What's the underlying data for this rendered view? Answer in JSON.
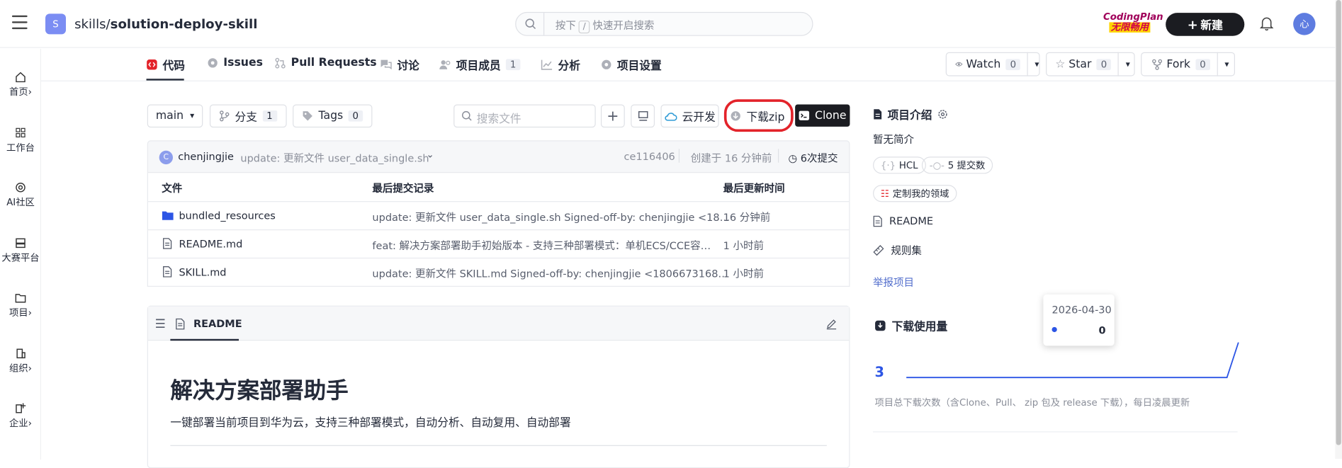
{
  "topbar": {
    "repo_avatar": "S",
    "repo_owner": "skills/",
    "repo_name": "solution-deploy-skill",
    "search_prefix": "按下",
    "search_key": "/",
    "search_suffix": "快速开启搜索",
    "badge_line1": "CodingPlan",
    "badge_line2": "无限畅用",
    "new_button": "新建",
    "user_avatar": "心"
  },
  "leftnav": [
    {
      "label": "首页",
      "icon": "home-icon",
      "arrow": "›"
    },
    {
      "label": "工作台",
      "icon": "grid-icon",
      "arrow": ""
    },
    {
      "label": "AI社区",
      "icon": "ai-icon",
      "arrow": ""
    },
    {
      "label": "大赛平台",
      "icon": "contest-icon",
      "arrow": ""
    },
    {
      "label": "项目",
      "icon": "folder-icon",
      "arrow": "›"
    },
    {
      "label": "组织",
      "icon": "org-icon",
      "arrow": "›"
    },
    {
      "label": "企业",
      "icon": "enterprise-icon",
      "arrow": "›"
    }
  ],
  "tabs": [
    {
      "label": "代码",
      "icon": "code-icon",
      "count": ""
    },
    {
      "label": "Issues",
      "icon": "issues-icon",
      "count": ""
    },
    {
      "label": "Pull Requests",
      "icon": "pr-icon",
      "count": ""
    },
    {
      "label": "讨论",
      "icon": "discuss-icon",
      "count": ""
    },
    {
      "label": "项目成员",
      "icon": "members-icon",
      "count": "1"
    },
    {
      "label": "分析",
      "icon": "analysis-icon",
      "count": ""
    },
    {
      "label": "项目设置",
      "icon": "settings-icon",
      "count": ""
    }
  ],
  "repo_actions": {
    "watch": {
      "label": "Watch",
      "count": "0"
    },
    "star": {
      "label": "Star",
      "count": "0"
    },
    "fork": {
      "label": "Fork",
      "count": "0"
    }
  },
  "toolbar": {
    "branch": "main",
    "branches_label": "分支",
    "branches_count": "1",
    "tags_label": "Tags",
    "tags_count": "0",
    "search_placeholder": "搜索文件",
    "cloud_dev": "云开发",
    "download_zip": "下载zip",
    "clone": "Clone"
  },
  "commit": {
    "author_initial": "C",
    "author": "chenjingjie",
    "message": "update: 更新文件 user_data_single.sh",
    "hash": "ce116406",
    "created": "创建于 16 分钟前",
    "commit_count": "6次提交"
  },
  "file_table": {
    "headers": [
      "文件",
      "最后提交记录",
      "最后更新时间"
    ],
    "rows": [
      {
        "name": "bundled_resources",
        "type": "folder",
        "message": "update: 更新文件 user_data_single.sh Signed-off-by: chenjingjie <18…",
        "time": "16 分钟前"
      },
      {
        "name": "README.md",
        "type": "file",
        "message": "feat: 解决方案部署助手初始版本 - 支持三种部署模式：单机ECS/CCE容…",
        "time": "1 小时前"
      },
      {
        "name": "SKILL.md",
        "type": "file",
        "message": "update: 更新文件 SKILL.md Signed-off-by: chenjingjie <1806673168…",
        "time": "1 小时前"
      }
    ]
  },
  "readme": {
    "tab_label": "README",
    "title": "解决方案部署助手",
    "subtitle": "一键部署当前项目到华为云，支持三种部署模式，自动分析、自动复用、自动部署"
  },
  "sidebar": {
    "intro_title": "项目介绍",
    "intro_text": "暂无简介",
    "lang_tag": "HCL",
    "commits_tag": "5 提交数",
    "domain_tag": "定制我的领域",
    "readme_link": "README",
    "rules_link": "规则集",
    "report_link": "举报项目",
    "downloads_title": "下载使用量",
    "downloads_total": "3",
    "downloads_note": "项目总下载次数（含Clone、Pull、 zip 包及 release 下载），每日凌晨更新",
    "tooltip_date": "2026-04-30",
    "tooltip_value": "0"
  },
  "chart_data": {
    "type": "line",
    "title": "下载使用量",
    "series": [
      {
        "values": [
          0,
          0,
          0,
          0,
          0,
          0,
          0,
          0,
          0,
          0,
          0,
          0,
          0,
          0,
          0,
          0,
          0,
          0,
          0,
          0,
          0,
          0,
          0,
          0,
          0,
          0,
          0,
          0,
          0,
          3
        ]
      }
    ],
    "total": 3,
    "grid": false,
    "colors": {
      "line": "#2c55e5"
    }
  },
  "colors": {
    "accent": "#5e7ce0",
    "link": "#526ecc",
    "highlight": "#e3232a",
    "dark": "#1b1c21"
  }
}
